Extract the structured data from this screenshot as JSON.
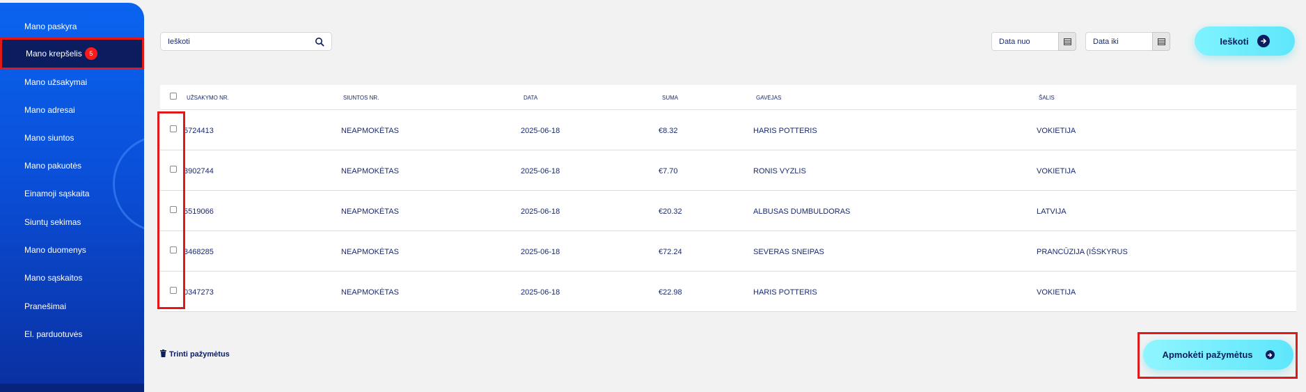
{
  "sidebar": {
    "items": [
      {
        "label": "Mano paskyra"
      },
      {
        "label": "Mano krepšelis",
        "badge": "5",
        "active": true
      },
      {
        "label": "Mano užsakymai"
      },
      {
        "label": "Mano adresai"
      },
      {
        "label": "Mano siuntos"
      },
      {
        "label": "Mano pakuotės"
      },
      {
        "label": "Einamoji sąskaita"
      },
      {
        "label": "Siuntų sekimas"
      },
      {
        "label": "Mano duomenys"
      },
      {
        "label": "Mano sąskaitos"
      },
      {
        "label": "Pranešimai"
      },
      {
        "label": "El. parduotuvės"
      }
    ]
  },
  "filters": {
    "search_placeholder": "Ieškoti",
    "date_from": "Data nuo",
    "date_to": "Data iki",
    "search_button": "Ieškoti"
  },
  "table": {
    "headers": {
      "order_no": "UŽSAKYMO NR.",
      "shipment_no": "SIUNTOS NR.",
      "date": "DATA",
      "amount": "SUMA",
      "recipient": "GAVĖJAS",
      "country": "ŠALIS"
    },
    "rows": [
      {
        "order_no": "5724413",
        "shipment_no": "NEAPMOKĖTAS",
        "date": "2025-06-18",
        "amount": "€8.32",
        "recipient": "HARIS POTTERIS",
        "country": "VOKIETIJA"
      },
      {
        "order_no": "3902744",
        "shipment_no": "NEAPMOKĖTAS",
        "date": "2025-06-18",
        "amount": "€7.70",
        "recipient": "RONIS VYZLIS",
        "country": "VOKIETIJA"
      },
      {
        "order_no": "5519066",
        "shipment_no": "NEAPMOKĖTAS",
        "date": "2025-06-18",
        "amount": "€20.32",
        "recipient": "ALBUSAS DUMBULDORAS",
        "country": "LATVIJA"
      },
      {
        "order_no": "3468285",
        "shipment_no": "NEAPMOKĖTAS",
        "date": "2025-06-18",
        "amount": "€72.24",
        "recipient": "SEVERAS SNEIPAS",
        "country": "PRANCŪZIJA (IŠSKYRUS"
      },
      {
        "order_no": "0347273",
        "shipment_no": "NEAPMOKĖTAS",
        "date": "2025-06-18",
        "amount": "€22.98",
        "recipient": "HARIS POTTERIS",
        "country": "VOKIETIJA"
      }
    ]
  },
  "actions": {
    "delete_selected": "Trinti pažymėtus",
    "pay_selected": "Apmokėti pažymėtus"
  },
  "colors": {
    "sidebar_blue": "#0a4fd8",
    "navy": "#0b1d5e",
    "accent_cyan": "#5ee6fb",
    "highlight_red": "#e01818",
    "badge_red": "#ff1a1a"
  }
}
